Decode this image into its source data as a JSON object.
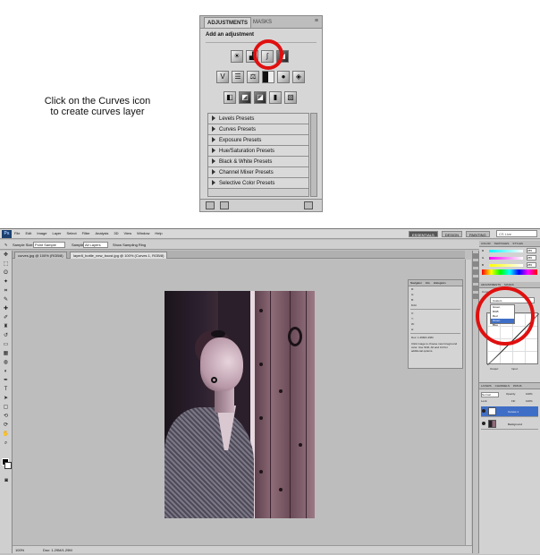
{
  "instruction": {
    "line1": "Click on the Curves icon",
    "line2": "to create curves layer"
  },
  "adjustments_panel": {
    "tabs": [
      "ADJUSTMENTS",
      "MASKS"
    ],
    "title": "Add an adjustment",
    "presets": [
      "Levels Presets",
      "Curves Presets",
      "Exposure Presets",
      "Hue/Saturation Presets",
      "Black & White Presets",
      "Channel Mixer Presets",
      "Selective Color Presets"
    ],
    "highlight_color": "#e01010"
  },
  "photoshop": {
    "logo": "Ps",
    "menu": [
      "File",
      "Edit",
      "Image",
      "Layer",
      "Select",
      "Filter",
      "Analysis",
      "3D",
      "View",
      "Window",
      "Help"
    ],
    "workspaces": [
      "ESSENTIALS",
      "DESIGN",
      "PAINTING"
    ],
    "search_placeholder": "CS Live",
    "options": {
      "sample_size_label": "Sample Size:",
      "sample_size_value": "Point Sample",
      "sample_label": "Sample:",
      "sample_value": "All Layers",
      "show_ring": "Show Sampling Ring"
    },
    "doc_tabs": [
      "curves.jpg @ 100% (RGB/8)",
      "layer8_bottle_new_boost.jpg @ 100% (Curves 1, RGB/8)"
    ],
    "status": {
      "zoom": "100%",
      "doc": "Doc: 1.29M/1.29M"
    },
    "info_panel": {
      "tabs": [
        "Navigator",
        "Info",
        "Histogram"
      ],
      "rows": [
        "R:",
        "G:",
        "B:",
        "8-bit",
        "X:",
        "Y:",
        "W:",
        "H:"
      ],
      "doc": "Doc: 1.29M/1.29M",
      "hint": "Click image to choose new foreground color. Use Shift, Alt and Ctrl for additional options."
    },
    "right": {
      "color_tabs": [
        "COLOR",
        "SWATCHES",
        "STYLES"
      ],
      "color_labels": [
        "R",
        "G",
        "B"
      ],
      "color_values": [
        "255",
        "255",
        "255"
      ],
      "adj_tabs": [
        "ADJUSTMENTS",
        "MASKS"
      ],
      "adj_title": "Curves",
      "preset_value": "Custom",
      "channels": [
        "Green",
        "RGB",
        "Red",
        "Green",
        "Blue"
      ],
      "output_label": "Output:",
      "input_label": "Input:",
      "layers_tabs": [
        "LAYERS",
        "CHANNELS",
        "PATHS"
      ],
      "blend_mode": "Normal",
      "opacity_label": "Opacity:",
      "opacity": "100%",
      "fill_label": "Fill:",
      "fill": "100%",
      "lock_label": "Lock:",
      "layers": [
        "Curves 1",
        "Background"
      ]
    }
  }
}
